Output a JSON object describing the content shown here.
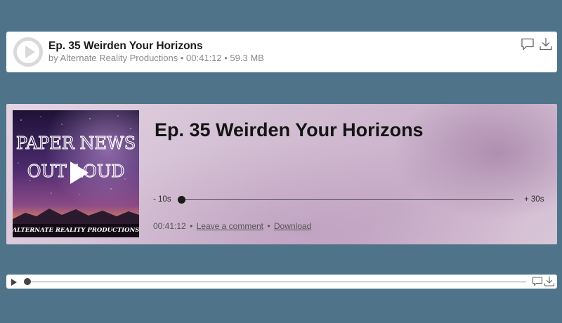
{
  "colors": {
    "page_background": "#4f7389",
    "card_background": "#ffffff",
    "featured_background": "#d3bfd4",
    "play_circle": "#d9d9d9"
  },
  "player_compact": {
    "title": "Ep. 35 Weirden Your Horizons",
    "meta": "by Alternate Reality Productions • 00:41:12 • 59.3 MB",
    "icons": [
      "play-icon",
      "comment-icon",
      "download-icon"
    ]
  },
  "player_featured": {
    "title": "Ep. 35 Weirden Your Horizons",
    "artwork": {
      "line1": "PAPER NEWS",
      "line2": "OUT LOUD",
      "footer": "ALTERNATE REALITY PRODUCTIONS"
    },
    "rewind_label": "- 10s",
    "forward_label": "+ 30s",
    "progress": 0,
    "duration": "00:41:12",
    "comment_link": "Leave a comment",
    "download_link": "Download",
    "separator": "•"
  },
  "player_slim": {
    "progress": 0,
    "icons": [
      "play-icon",
      "comment-icon",
      "download-icon"
    ]
  }
}
